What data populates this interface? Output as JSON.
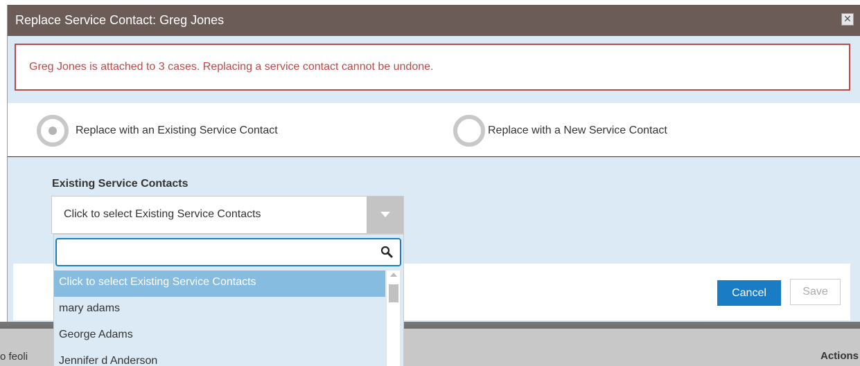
{
  "background": {
    "left_text": "o feoli",
    "right_text": "Actions"
  },
  "dialog": {
    "title": "Replace Service Contact: Greg Jones",
    "close_glyph": "✕",
    "alert_text": "Greg Jones is attached to 3 cases. Replacing a service contact cannot be undone.",
    "radio_options": [
      {
        "label": "Replace with an Existing Service Contact",
        "checked": true
      },
      {
        "label": "Replace with a New Service Contact",
        "checked": false
      }
    ],
    "field_label": "Existing Service Contacts",
    "select": {
      "value": "Click to select Existing Service Contacts"
    },
    "dropdown": {
      "search_value": "",
      "items": [
        "Click to select Existing Service Contacts",
        "mary adams",
        "George Adams",
        "Jennifer d Anderson"
      ],
      "selected_index": 0
    },
    "buttons": {
      "cancel": "Cancel",
      "save": "Save"
    }
  },
  "colors": {
    "titlebar": "#6b5c57",
    "alert": "#b94a48",
    "primary": "#1a7dc4",
    "highlight": "#86bce0",
    "panel": "#dbeaf4"
  }
}
